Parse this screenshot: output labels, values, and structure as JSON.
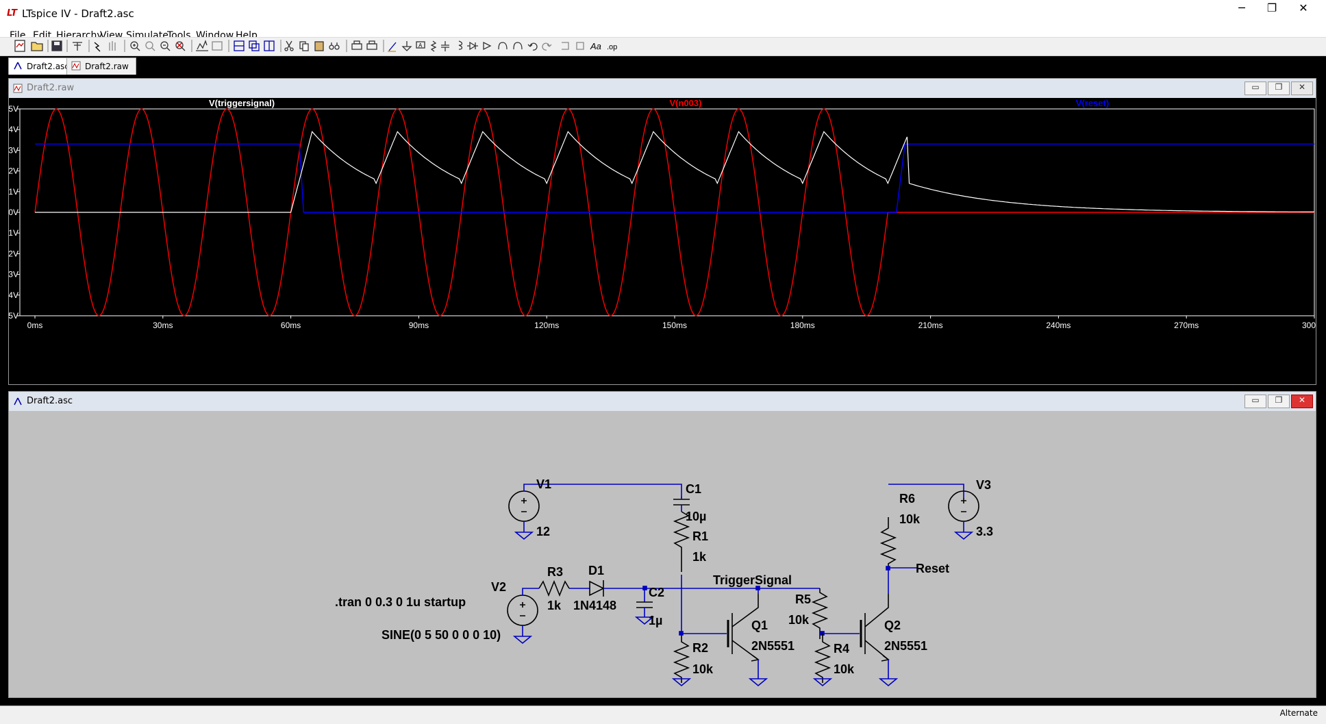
{
  "window": {
    "title": "LTspice IV - Draft2.asc",
    "icon": "ltspice-logo-icon",
    "buttons": {
      "minimize": "─",
      "maximize": "❐",
      "close": "✕"
    }
  },
  "menu": {
    "items": [
      {
        "label": "File"
      },
      {
        "label": "Edit"
      },
      {
        "label": "Hierarchy"
      },
      {
        "label": "View"
      },
      {
        "label": "Simulate"
      },
      {
        "label": "Tools"
      },
      {
        "label": "Window"
      },
      {
        "label": "Help"
      }
    ]
  },
  "tabs": [
    {
      "label": "Draft2.asc",
      "icon": "schematic-icon",
      "active": true
    },
    {
      "label": "Draft2.raw",
      "icon": "waveform-icon",
      "active": false
    }
  ],
  "plot_window": {
    "title": "Draft2.raw",
    "traces": [
      {
        "label": "V(triggersignal)",
        "color": "#ffffff"
      },
      {
        "label": "V(n003)",
        "color": "#ff0000"
      },
      {
        "label": "V(reset)",
        "color": "#0000ff"
      }
    ],
    "yticks": [
      "5V",
      "4V",
      "3V",
      "2V",
      "1V",
      "0V",
      "-1V",
      "-2V",
      "-3V",
      "-4V",
      "-5V"
    ],
    "xticks": [
      "0ms",
      "30ms",
      "60ms",
      "90ms",
      "120ms",
      "150ms",
      "180ms",
      "210ms",
      "240ms",
      "270ms",
      "300ms"
    ]
  },
  "chart_data": {
    "type": "line",
    "x_unit": "ms",
    "xlim": [
      0,
      300
    ],
    "ylim": [
      -5,
      5
    ],
    "grid": false,
    "legend": "top",
    "series": [
      {
        "name": "V(triggersignal)",
        "color": "#ffffff",
        "description_points": [
          [
            0,
            0
          ],
          [
            60,
            0
          ],
          [
            65,
            3.9
          ],
          [
            80,
            1.4
          ],
          [
            85,
            3.9
          ],
          [
            100,
            1.4
          ],
          [
            105,
            3.9
          ],
          [
            120,
            1.4
          ],
          [
            125,
            3.9
          ],
          [
            140,
            1.4
          ],
          [
            145,
            3.9
          ],
          [
            160,
            1.4
          ],
          [
            165,
            3.9
          ],
          [
            180,
            1.4
          ],
          [
            185,
            3.9
          ],
          [
            200,
            1.4
          ],
          [
            210,
            0.8
          ],
          [
            240,
            0.3
          ],
          [
            270,
            0.05
          ],
          [
            300,
            0
          ]
        ]
      },
      {
        "name": "V(n003)",
        "color": "#ff0000",
        "amplitude": 5,
        "frequency_hz": 50,
        "active_until_ms": 200
      },
      {
        "name": "V(reset)",
        "color": "#0000ff",
        "points": [
          [
            0,
            3.3
          ],
          [
            62,
            3.3
          ],
          [
            63,
            0
          ],
          [
            202,
            0
          ],
          [
            204,
            3.3
          ],
          [
            300,
            3.3
          ]
        ]
      }
    ]
  },
  "schematic_window": {
    "title": "Draft2.asc",
    "labels": {
      "v1": "V1",
      "v1_val": "12",
      "v2": "V2",
      "v2_val": "SINE(0 5 50 0 0 0 10)",
      "v3": "V3",
      "v3_val": "3.3",
      "c1": "C1",
      "c1_val": "10µ",
      "c2": "C2",
      "c2_val": "1µ",
      "r1": "R1",
      "r1_val": "1k",
      "r2": "R2",
      "r2_val": "10k",
      "r3": "R3",
      "r3_val": "1k",
      "r4": "R4",
      "r4_val": "10k",
      "r5": "R5",
      "r5_val": "10k",
      "r6": "R6",
      "r6_val": "10k",
      "d1": "D1",
      "d1_val": "1N4148",
      "q1": "Q1",
      "q1_val": "2N5551",
      "q2": "Q2",
      "q2_val": "2N5551",
      "net_trigger": "TriggerSignal",
      "net_reset": "Reset",
      "directive": ".tran 0 0.3 0 1u startup"
    }
  },
  "status": {
    "text": "Alternate"
  }
}
